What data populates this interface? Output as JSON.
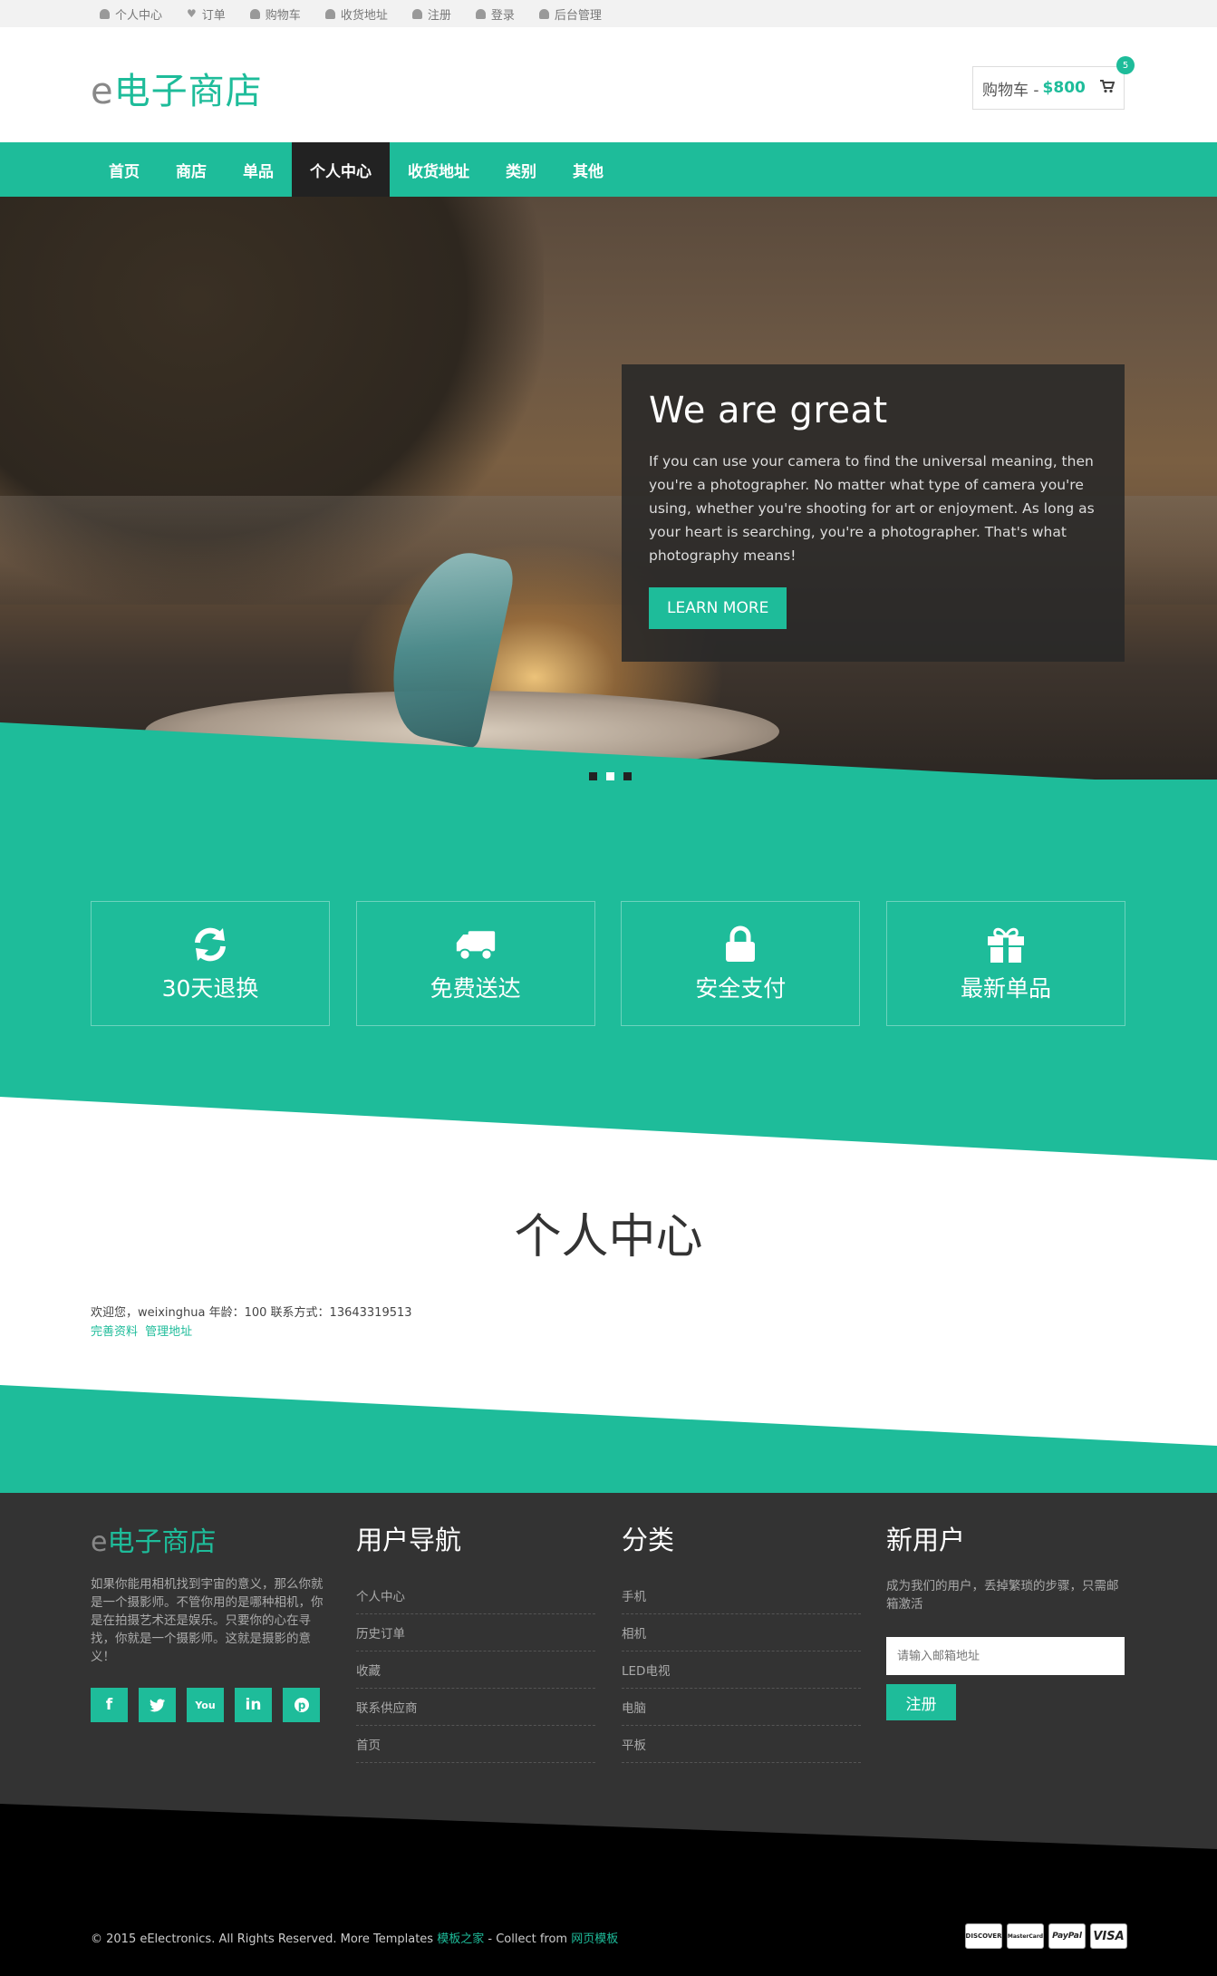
{
  "topbar": {
    "items": [
      {
        "label": "个人中心",
        "icon": "user-icon"
      },
      {
        "label": "订单",
        "icon": "heart-icon"
      },
      {
        "label": "购物车",
        "icon": "user-icon"
      },
      {
        "label": "收货地址",
        "icon": "user-icon"
      },
      {
        "label": "注册",
        "icon": "user-icon"
      },
      {
        "label": "登录",
        "icon": "user-icon"
      },
      {
        "label": "后台管理",
        "icon": "user-icon"
      }
    ]
  },
  "header": {
    "logo_prefix": "e",
    "logo_main": "电子商店",
    "cart_label": "购物车 -",
    "cart_amount": "$800",
    "cart_count": "5"
  },
  "nav": {
    "items": [
      "首页",
      "商店",
      "单品",
      "个人中心",
      "收货地址",
      "类别",
      "其他"
    ],
    "active": "个人中心"
  },
  "hero": {
    "title": "We are great",
    "text": "If you can use your camera to find the universal meaning, then you're a photographer. No matter what type of camera you're using, whether you're shooting for art or enjoyment. As long as your heart is searching, you're a photographer. That's what photography means!",
    "button": "LEARN MORE"
  },
  "features": [
    {
      "label": "30天退换",
      "icon": "refresh-icon"
    },
    {
      "label": "免费送达",
      "icon": "truck-icon"
    },
    {
      "label": "安全支付",
      "icon": "lock-icon"
    },
    {
      "label": "最新单品",
      "icon": "gift-icon"
    }
  ],
  "personal": {
    "title": "个人中心",
    "info": "欢迎您，weixinghua 年龄：100 联系方式：13643319513",
    "link_profile": "完善资料",
    "link_address": "管理地址"
  },
  "footer": {
    "logo_prefix": "e",
    "logo_main": "电子商店",
    "desc": "如果你能用相机找到宇宙的意义，那么你就是一个摄影师。不管你用的是哪种相机，你是在拍摄艺术还是娱乐。只要你的心在寻找，你就是一个摄影师。这就是摄影的意义！",
    "social": [
      "f",
      "t",
      "You",
      "in",
      "p"
    ],
    "nav_title": "用户导航",
    "nav_items": [
      "个人中心",
      "历史订单",
      "收藏",
      "联系供应商",
      "首页"
    ],
    "cat_title": "分类",
    "cat_items": [
      "手机",
      "相机",
      "LED电视",
      "电脑",
      "平板"
    ],
    "new_title": "新用户",
    "new_desc": "成为我们的用户，丢掉繁琐的步骤，只需邮箱激活",
    "email_placeholder": "请输入邮箱地址",
    "register": "注册"
  },
  "copyright": {
    "text": "© 2015 eElectronics. All Rights Reserved. More Templates",
    "link1": "模板之家",
    "mid": "- Collect from",
    "link2": "网页模板"
  },
  "payments": [
    "DISCOVER",
    "MasterCard",
    "PayPal",
    "VISA"
  ],
  "colors": {
    "accent": "#1ebc9a",
    "dark": "#333333",
    "black": "#000000"
  }
}
